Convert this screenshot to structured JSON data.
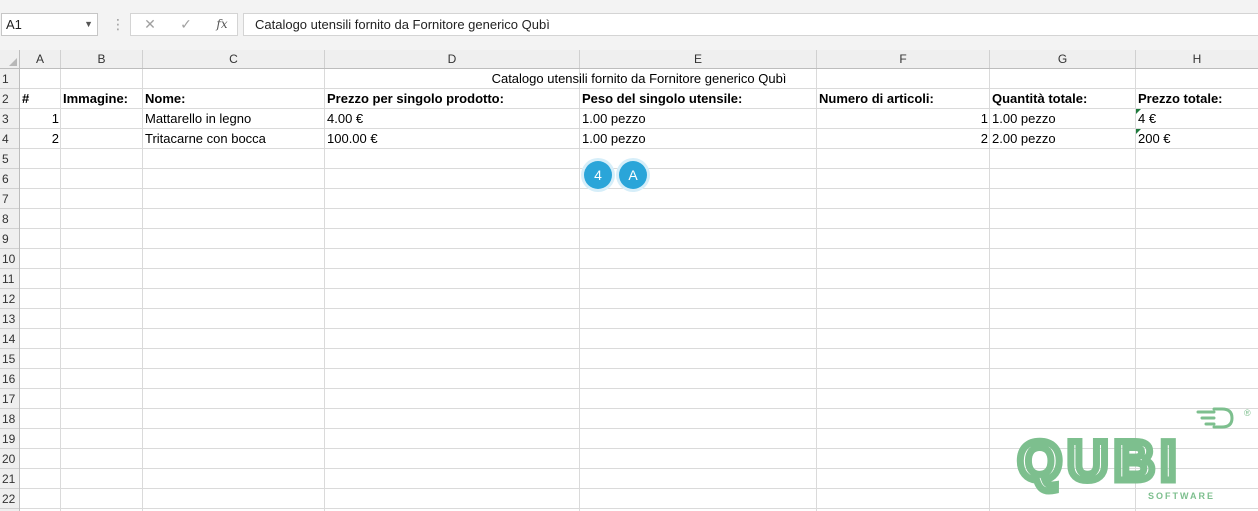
{
  "formula_bar": {
    "name_box": "A1",
    "formula_value": "Catalogo utensili fornito da Fornitore generico Qubì"
  },
  "columns": [
    "A",
    "B",
    "C",
    "D",
    "E",
    "F",
    "G",
    "H"
  ],
  "rows": [
    "1",
    "2",
    "3",
    "4",
    "5",
    "6",
    "7",
    "8",
    "9",
    "10",
    "11",
    "12",
    "13",
    "14",
    "15",
    "16",
    "17",
    "18",
    "19",
    "20",
    "21",
    "22"
  ],
  "sheet": {
    "title": "Catalogo utensili fornito da Fornitore generico Qubì",
    "headers": {
      "num": "#",
      "image": "Immagine:",
      "name": "Nome:",
      "unit_price": "Prezzo per singolo prodotto:",
      "unit_weight": "Peso del singolo utensile:",
      "item_count": "Numero di articoli:",
      "total_qty": "Quantità totale:",
      "total_price": "Prezzo totale:"
    },
    "rows": [
      {
        "num": "1",
        "name": "Mattarello in legno",
        "unit_price": "4.00 €",
        "unit_weight": "1.00 pezzo",
        "item_count": "1",
        "total_qty": "1.00 pezzo",
        "total_price": "4 €"
      },
      {
        "num": "2",
        "name": "Tritacarne con bocca",
        "unit_price": "100.00 €",
        "unit_weight": "1.00 pezzo",
        "item_count": "2",
        "total_qty": "2.00 pezzo",
        "total_price": "200 €"
      }
    ]
  },
  "overlay": {
    "circle_1": "4",
    "circle_2": "A"
  },
  "logo": {
    "word": "QUBI",
    "sub": "SOFTWARE",
    "mark": "®",
    "color": "#7dbf8e"
  }
}
